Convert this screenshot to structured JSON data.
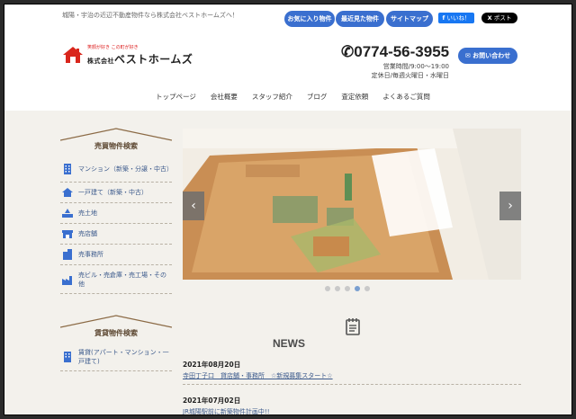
{
  "header": {
    "tagline": "城陽・宇治の近辺不動産物件なら株式会社ベストホームズへ！",
    "buttons": [
      "お気に入り物件",
      "最近見た物件",
      "サイトマップ"
    ],
    "facebook_label": "いいね！",
    "x_label": "ポスト",
    "logo_small": "笑顔が好き この町が好き",
    "logo_prefix": "株式会社",
    "logo_name": "ベストホームズ",
    "phone": "0774-56-3955",
    "hours": "営業時間/9:00〜19:00",
    "holidays": "定休日/毎週火曜日・水曜日",
    "contact_label": "お問い合わせ"
  },
  "nav": [
    "トップページ",
    "会社概要",
    "スタッフ紹介",
    "ブログ",
    "査定依頼",
    "よくあるご質問"
  ],
  "sidebar": {
    "sale_heading": "売買物件検索",
    "sale_items": [
      {
        "label": "マンション（新築・分譲・中古）",
        "icon": "building-icon"
      },
      {
        "label": "一戸建て（新築・中古）",
        "icon": "house-icon"
      },
      {
        "label": "売土地",
        "icon": "land-icon"
      },
      {
        "label": "売店舗",
        "icon": "shop-icon"
      },
      {
        "label": "売事務所",
        "icon": "office-icon"
      },
      {
        "label": "売ビル・売倉庫・売工場・その他",
        "icon": "factory-icon"
      }
    ],
    "rent_heading": "賃貸物件検索",
    "rent_items": [
      {
        "label": "賃貸(アパート・マンション・一戸建て)",
        "icon": "building-icon"
      }
    ]
  },
  "slider": {
    "prev": "‹",
    "next": "›",
    "slide_count": 5,
    "active_index": 3
  },
  "news": {
    "title": "NEWS",
    "items": [
      {
        "date": "2021年08月20日",
        "text": "寺田丁子口　貸店舗・事務所　☆新規募集スタート☆"
      },
      {
        "date": "2021年07月02日",
        "text": "JR城陽駅前に新築物件計画中!!"
      }
    ]
  },
  "colors": {
    "accent": "#3a6fcf",
    "link": "#3c5a8c",
    "background": "#f3f1ec"
  }
}
